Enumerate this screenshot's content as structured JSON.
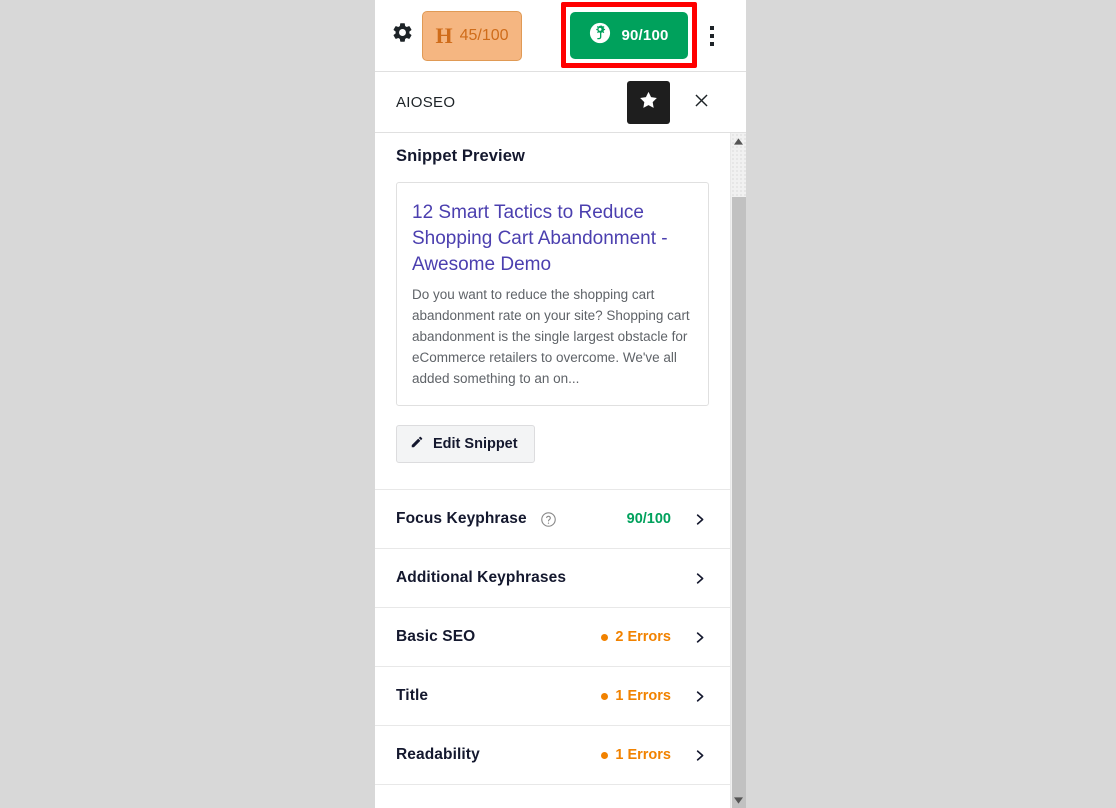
{
  "toolbar": {
    "gear_icon": "gear-icon",
    "kebab_icon": "kebab-menu-icon",
    "headline_badge": {
      "letter": "H",
      "score": "45/100"
    },
    "aioseo_badge": {
      "icon": "aioseo-logo-icon",
      "score": "90/100",
      "highlight_color": "#ff0000",
      "background_color": "#00a15c"
    }
  },
  "sidebar": {
    "title": "AIOSEO",
    "star_icon": "star-icon",
    "close_icon": "close-icon",
    "snippet": {
      "heading": "Snippet Preview",
      "title": "12 Smart Tactics to Reduce Shopping Cart Abandonment - Awesome Demo",
      "description": "Do you want to reduce the shopping cart abandonment rate on your site? Shopping cart abandonment is the single largest obstacle for eCommerce retailers to overcome. We've all added something to an on...",
      "edit_button_label": "Edit Snippet",
      "edit_button_icon": "pencil-icon"
    },
    "rows": [
      {
        "label": "Focus Keyphrase",
        "has_help_icon": true,
        "help_icon": "question-mark-icon",
        "status": "90/100",
        "status_type": "score",
        "chevron_icon": "chevron-right-icon"
      },
      {
        "label": "Additional Keyphrases",
        "has_help_icon": false,
        "status": "",
        "status_type": "none",
        "chevron_icon": "chevron-right-icon"
      },
      {
        "label": "Basic SEO",
        "has_help_icon": false,
        "status": "2 Errors",
        "status_type": "errors",
        "chevron_icon": "chevron-right-icon"
      },
      {
        "label": "Title",
        "has_help_icon": false,
        "status": "1 Errors",
        "status_type": "errors",
        "chevron_icon": "chevron-right-icon"
      },
      {
        "label": "Readability",
        "has_help_icon": false,
        "status": "1 Errors",
        "status_type": "errors",
        "chevron_icon": "chevron-right-icon"
      }
    ]
  },
  "scrollbar": {
    "up_icon": "scroll-up-arrow-icon",
    "down_icon": "scroll-down-arrow-icon",
    "thumb": "scrollbar-thumb"
  },
  "colors": {
    "green_score": "#00a15c",
    "orange_error": "#f18200",
    "headline_badge_bg": "#f5b681",
    "headline_badge_text": "#cf6c1a",
    "snippet_link": "#4b3faf",
    "highlight_rect": "#ff0000"
  }
}
